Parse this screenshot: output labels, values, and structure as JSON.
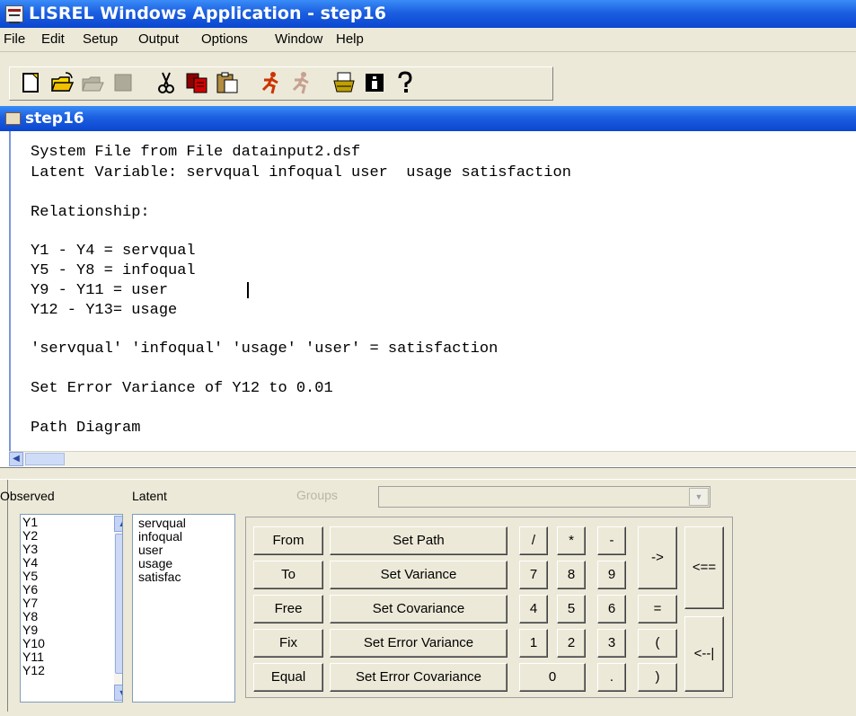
{
  "window": {
    "title": "LISREL Windows Application - step16"
  },
  "menu": [
    "File",
    "Edit",
    "Setup",
    "Output",
    "Options",
    "Window",
    "Help"
  ],
  "toolbar": {
    "buttons": [
      "new-file-icon",
      "open-folder-icon",
      "save-icon",
      "disabled-icon",
      "cut-icon",
      "copy-icon",
      "paste-icon",
      "run-icon",
      "run-disabled-icon",
      "print-icon",
      "info-icon",
      "help-icon"
    ]
  },
  "document": {
    "title": "step16",
    "lines": [
      "System File from File datainput2.dsf",
      "Latent Variable: servqual infoqual user  usage satisfaction",
      "Relationship:",
      "Y1 - Y4 = servqual",
      "Y5 - Y8 = infoqual",
      "Y9 - Y11 = user",
      "Y12 - Y13= usage",
      "'servqual' 'infoqual' 'usage' 'user' = satisfaction",
      "Set Error Variance of Y12 to 0.01",
      "Path Diagram"
    ]
  },
  "panel": {
    "observed_label": "Observed",
    "latent_label": "Latent",
    "groups_label": "Groups",
    "groups_value": "",
    "observed": [
      "Y1",
      "Y2",
      "Y3",
      "Y4",
      "Y5",
      "Y6",
      "Y7",
      "Y8",
      "Y9",
      "Y10",
      "Y11",
      "Y12"
    ],
    "latent": [
      "servqual",
      "infoqual",
      "user",
      "usage",
      "satisfac"
    ],
    "keyword_buttons": [
      "From",
      "To",
      "Free",
      "Fix",
      "Equal"
    ],
    "command_buttons": [
      "Set Path",
      "Set Variance",
      "Set Covariance",
      "Set Error Variance",
      "Set Error Covariance"
    ],
    "keypad": {
      "row1": [
        "/",
        "*",
        "-"
      ],
      "row2": [
        "7",
        "8",
        "9"
      ],
      "row3": [
        "4",
        "5",
        "6"
      ],
      "row4": [
        "1",
        "2",
        "3"
      ],
      "zero": "0",
      "dot": ".",
      "arrow": "->",
      "equals": "=",
      "lparen": "(",
      "rparen": ")",
      "back_all": "<==",
      "enter": "<--|"
    }
  },
  "colors": {
    "titlebar": "#0a46d0",
    "face": "#ece9d8",
    "list_border": "#7f9db9"
  }
}
